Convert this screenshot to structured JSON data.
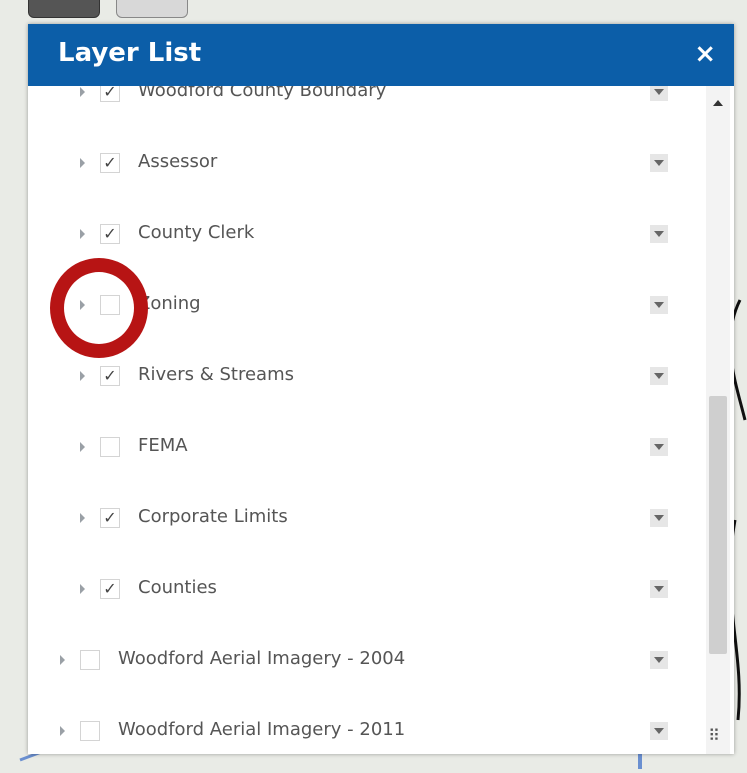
{
  "panel": {
    "title": "Layer List",
    "close_glyph": "×"
  },
  "layers": [
    {
      "label": "Woodford County Boundary",
      "checked": true,
      "level": 1
    },
    {
      "label": "Assessor",
      "checked": true,
      "level": 1
    },
    {
      "label": "County Clerk",
      "checked": true,
      "level": 1
    },
    {
      "label": "Zoning",
      "checked": false,
      "level": 1
    },
    {
      "label": "Rivers & Streams",
      "checked": true,
      "level": 1
    },
    {
      "label": "FEMA",
      "checked": false,
      "level": 1
    },
    {
      "label": "Corporate Limits",
      "checked": true,
      "level": 1
    },
    {
      "label": "Counties",
      "checked": true,
      "level": 1
    },
    {
      "label": "Woodford Aerial Imagery - 2004",
      "checked": false,
      "level": 0
    },
    {
      "label": "Woodford Aerial Imagery - 2011",
      "checked": false,
      "level": 0
    }
  ],
  "icons": {
    "check": "✓",
    "grip": "⠿"
  },
  "colors": {
    "header_bg": "#0c5ea8",
    "annotation_ring": "#b71414"
  }
}
